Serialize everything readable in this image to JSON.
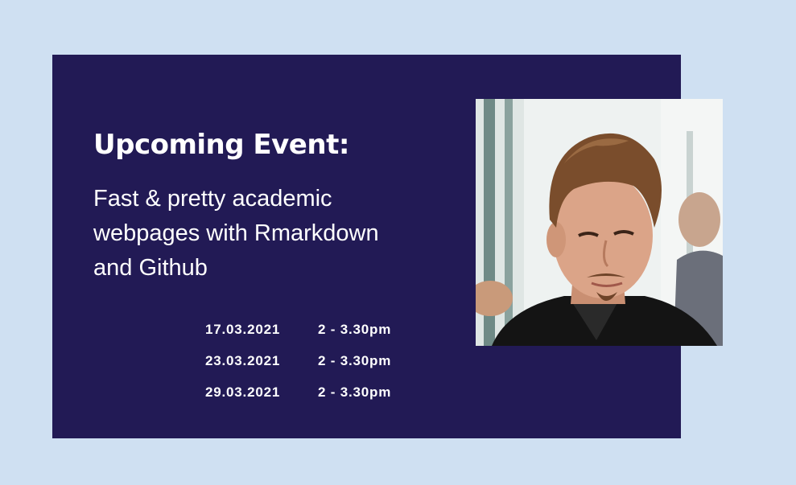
{
  "event": {
    "heading": "Upcoming Event:",
    "title_lines": [
      "Fast & pretty academic",
      "webpages with Rmarkdown",
      "and Github"
    ],
    "sessions": [
      {
        "date": "17.03.2021",
        "time": "2 - 3.30pm"
      },
      {
        "date": "23.03.2021",
        "time": "2 - 3.30pm"
      },
      {
        "date": "29.03.2021",
        "time": "2 - 3.30pm"
      }
    ]
  },
  "colors": {
    "page_background": "#cfe0f2",
    "card_background": "#221a55",
    "text": "#ffffff"
  }
}
